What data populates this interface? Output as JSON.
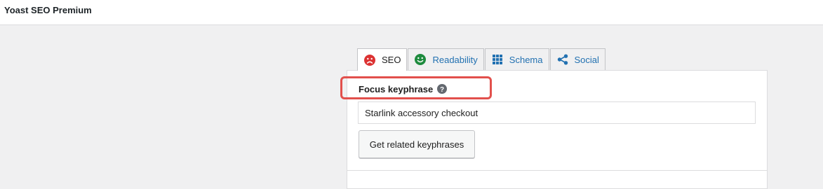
{
  "header": {
    "title": "Yoast SEO Premium"
  },
  "tabs": [
    {
      "label": "SEO",
      "icon": "sad-face-icon",
      "active": true
    },
    {
      "label": "Readability",
      "icon": "smiley-face-icon",
      "active": false
    },
    {
      "label": "Schema",
      "icon": "grid-icon",
      "active": false
    },
    {
      "label": "Social",
      "icon": "share-icon",
      "active": false
    }
  ],
  "seo": {
    "focus_label": "Focus keyphrase",
    "help_icon": "question-circle-icon",
    "keyphrase_value": "Starlink accessory checkout",
    "related_button": "Get related keyphrases"
  },
  "colors": {
    "bad": "#dc3232",
    "good": "#1e8b3e",
    "link": "#2271b1",
    "highlight": "#e2504c"
  }
}
